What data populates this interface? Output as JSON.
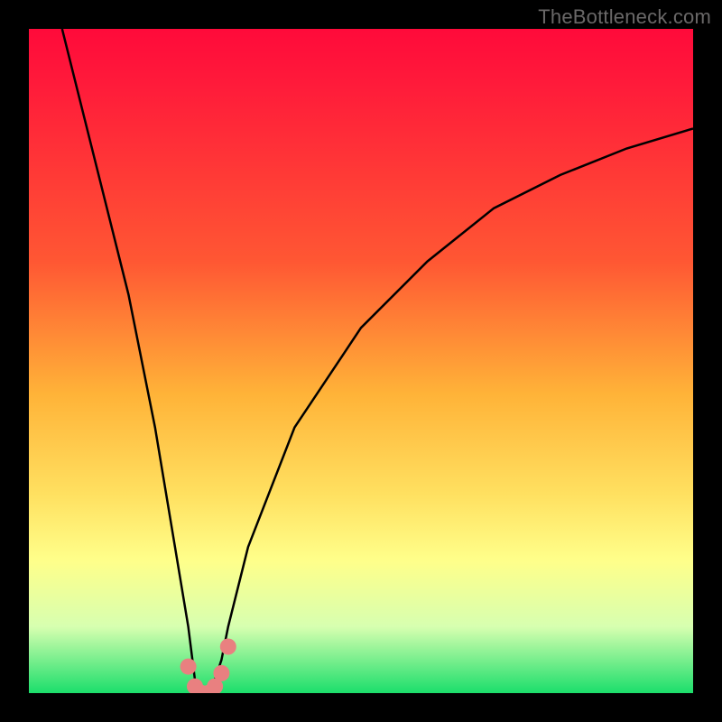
{
  "watermark": "TheBottleneck.com",
  "chart_data": {
    "type": "line",
    "title": "",
    "xlabel": "",
    "ylabel": "",
    "xlim": [
      0,
      100
    ],
    "ylim": [
      0,
      100
    ],
    "background_gradient": {
      "top": "#ff0a3a",
      "bottom": "#1bde6b",
      "meaning": "top=red=bad, bottom=green=good"
    },
    "series": [
      {
        "name": "bottleneck-curve",
        "x": [
          5,
          10,
          15,
          19,
          22,
          24,
          25,
          26,
          27,
          28,
          29,
          30,
          33,
          40,
          50,
          60,
          70,
          80,
          90,
          100
        ],
        "values": [
          100,
          80,
          60,
          40,
          22,
          10,
          2,
          0,
          0,
          2,
          5,
          10,
          22,
          40,
          55,
          65,
          73,
          78,
          82,
          85
        ]
      }
    ],
    "markers": [
      {
        "x": 24,
        "y": 4
      },
      {
        "x": 25,
        "y": 1
      },
      {
        "x": 26,
        "y": 0
      },
      {
        "x": 27,
        "y": 0
      },
      {
        "x": 28,
        "y": 1
      },
      {
        "x": 29,
        "y": 3
      },
      {
        "x": 30,
        "y": 7
      }
    ],
    "marker_color": "#e98080",
    "curve_color": "#000000"
  }
}
